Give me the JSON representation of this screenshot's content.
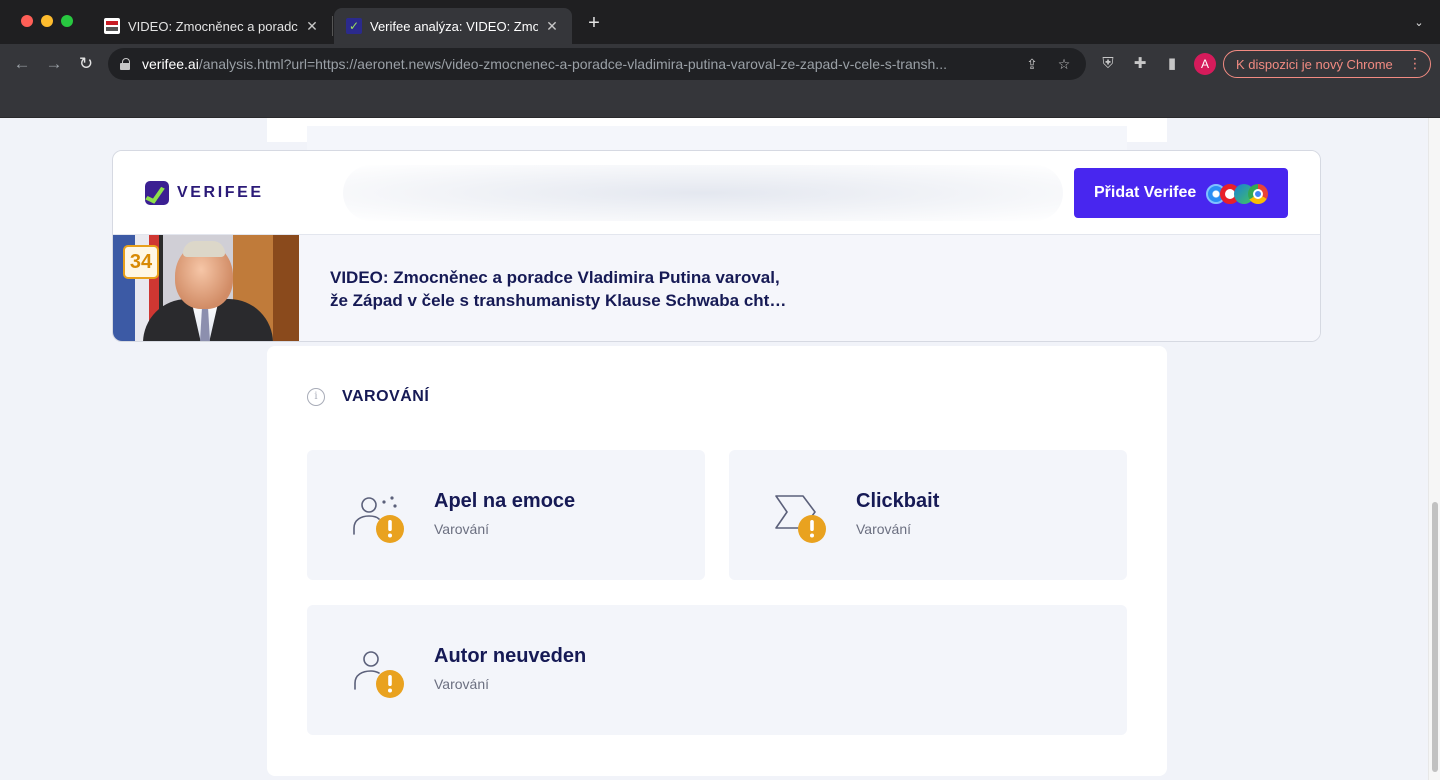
{
  "browser": {
    "tabs": [
      {
        "title": "VIDEO: Zmocněnec a poradce",
        "close": "✕"
      },
      {
        "title": "Verifee analýza: VIDEO: Zmocn",
        "close": "✕"
      }
    ],
    "new_tab": "+",
    "tab_search": "⌄",
    "nav": {
      "back": "←",
      "forward": "→",
      "reload": "↻"
    },
    "url_host": "verifee.ai",
    "url_rest": "/analysis.html?url=https://aeronet.news/video-zmocnenec-a-poradce-vladimira-putina-varoval-ze-zapad-v-cele-s-transh...",
    "omnibox_icons": {
      "share": "⇪",
      "star": "☆"
    },
    "toolbar_icons": {
      "shield": "⛨",
      "extensions": "✚",
      "sidebar": "▮"
    },
    "avatar_letter": "A",
    "update_label": "K dispozici je nový Chrome",
    "menu": "⋮"
  },
  "sticky": {
    "brand": "VERIFEE",
    "add_button": "Přidat Verifee",
    "article": {
      "score": "34",
      "title_line1": "VIDEO: Zmocněnec a poradce Vladimira Putina varoval,",
      "title_line2": "že Západ v čele s transhumanisty Klause Schwaba cht…"
    }
  },
  "warnings": {
    "info_icon": "i",
    "section_title": "VAROVÁNÍ",
    "items": [
      {
        "title": "Apel na emoce",
        "subtitle": "Varování",
        "icon": "emotion-warning-icon"
      },
      {
        "title": "Clickbait",
        "subtitle": "Varování",
        "icon": "clickbait-warning-icon"
      },
      {
        "title": "Autor neuveden",
        "subtitle": "Varování",
        "icon": "author-missing-warning-icon"
      }
    ]
  },
  "colors": {
    "accent": "#4826ef",
    "warning": "#e9a21f",
    "heading": "#161a55",
    "score_border": "#e8a01b"
  }
}
